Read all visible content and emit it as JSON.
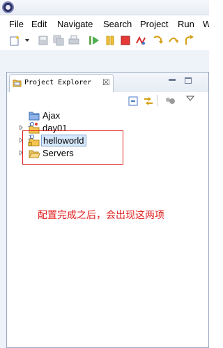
{
  "app": {
    "icon": "eclipse-icon"
  },
  "menubar": {
    "items": [
      "File",
      "Edit",
      "Navigate",
      "Search",
      "Project",
      "Run",
      "W"
    ]
  },
  "toolbar": {
    "icons": [
      "new-wizard-icon",
      "dropdown-arrow-icon",
      "save-icon",
      "save-all-icon",
      "print-icon",
      "run-icon",
      "suspend-icon",
      "terminate-icon",
      "disconnect-icon",
      "step-into-icon",
      "step-over-icon",
      "step-return-icon"
    ]
  },
  "panel": {
    "tab_label": "Project Explorer",
    "tab_close": "☒",
    "view_icons": [
      "collapse-all-icon",
      "link-with-editor-icon",
      "view-menu-icon"
    ]
  },
  "tree": {
    "nodes": [
      {
        "label": "Ajax",
        "icon": "project-folder-icon",
        "expandable": false,
        "selected": false
      },
      {
        "label": "day01",
        "icon": "java-project-icon",
        "expandable": true,
        "selected": false
      },
      {
        "label": "helloworld",
        "icon": "java-project-icon",
        "expandable": true,
        "selected": true
      },
      {
        "label": "Servers",
        "icon": "open-folder-icon",
        "expandable": true,
        "selected": false
      }
    ]
  },
  "annotation": {
    "text": "配置完成之后，会出现这两项",
    "color": "#e02020"
  },
  "colors": {
    "highlight_box": "#e02020",
    "selection": "#d6e8fb",
    "panel_border": "#99a8c2"
  }
}
